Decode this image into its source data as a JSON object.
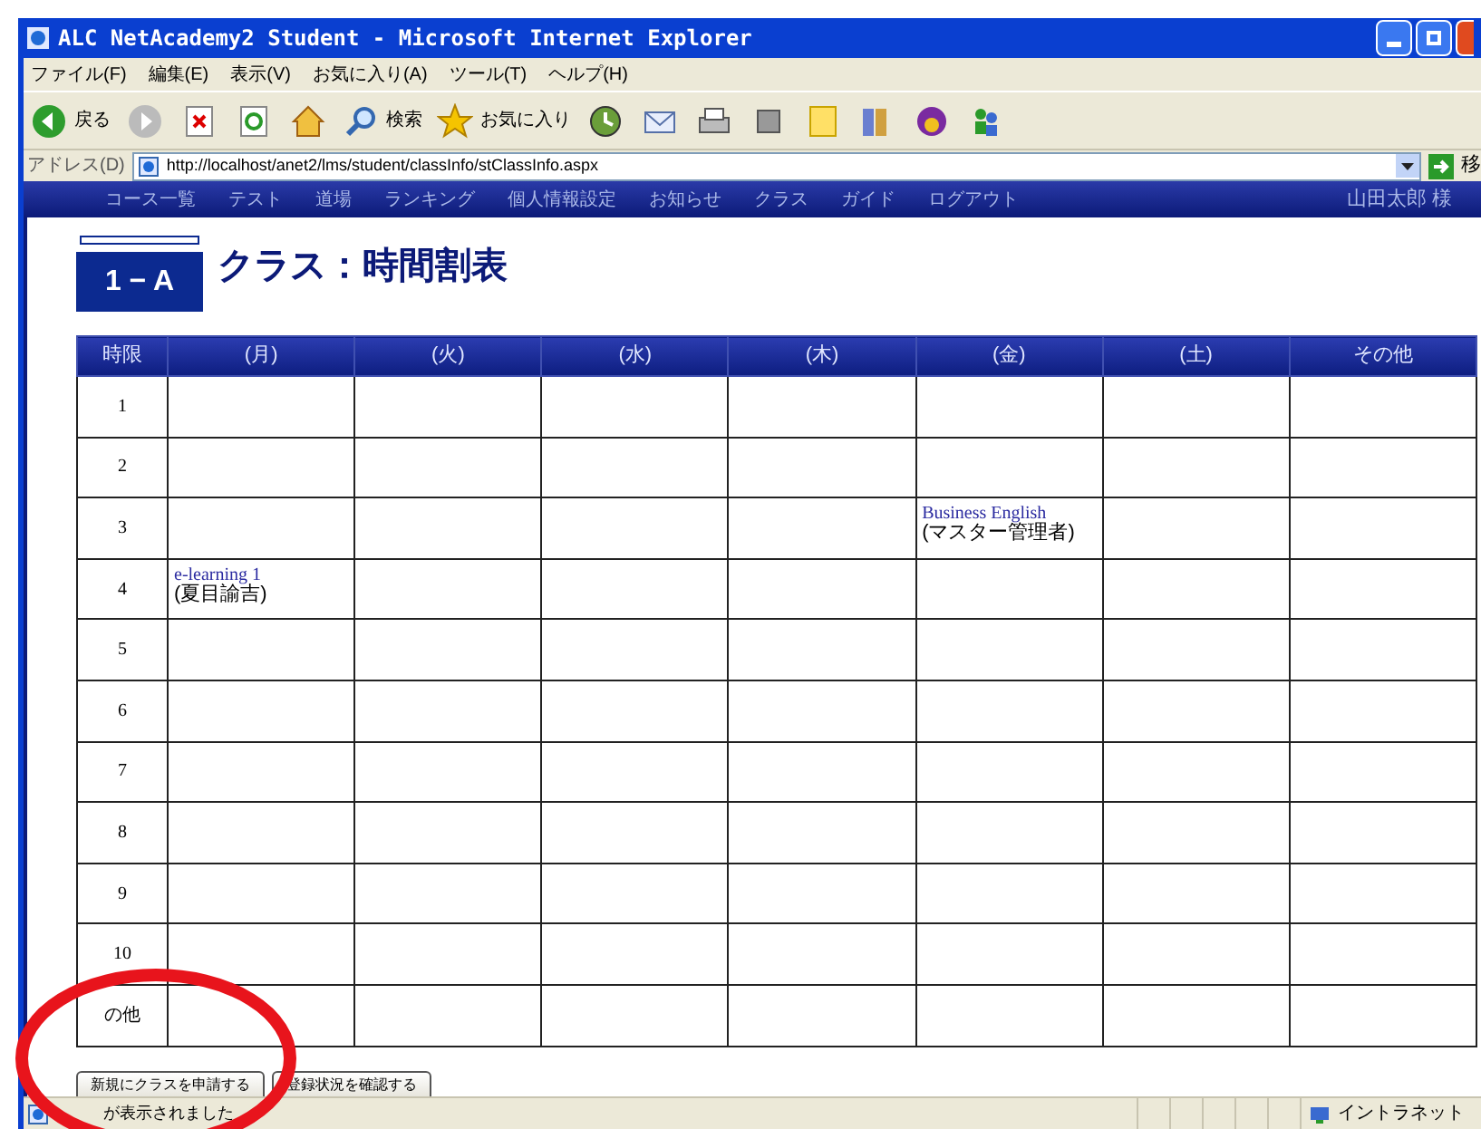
{
  "window": {
    "title": "ALC NetAcademy2 Student - Microsoft Internet Explorer"
  },
  "menu_bar": [
    "ファイル(F)",
    "編集(E)",
    "表示(V)",
    "お気に入り(A)",
    "ツール(T)",
    "ヘルプ(H)"
  ],
  "toolbar": {
    "back": "戻る",
    "search": "検索",
    "favorites": "お気に入り"
  },
  "address_bar": {
    "label": "アドレス(D)",
    "value": "http://localhost/anet2/lms/student/classInfo/stClassInfo.aspx",
    "go": "移"
  },
  "nav": {
    "items": [
      "コース一覧",
      "テスト",
      "道場",
      "ランキング",
      "個人情報設定",
      "お知らせ",
      "クラス",
      "ガイド",
      "ログアウト"
    ],
    "user": "山田太郎 様"
  },
  "page": {
    "logo": "1 − A",
    "title": "クラス：時間割表"
  },
  "table": {
    "columns": [
      "時限",
      "(月)",
      "(火)",
      "(水)",
      "(木)",
      "(金)",
      "(土)",
      "その他"
    ],
    "rows": [
      [
        {
          "period": "1"
        },
        {},
        {},
        {},
        {},
        {},
        {},
        {}
      ],
      [
        {
          "period": "2"
        },
        {},
        {},
        {},
        {},
        {},
        {},
        {}
      ],
      [
        {
          "period": "3"
        },
        {},
        {},
        {},
        {},
        {
          "course": "Business English",
          "teacher": "(マスター管理者)"
        },
        {},
        {}
      ],
      [
        {
          "period": "4"
        },
        {
          "course": "e-learning 1",
          "teacher": "(夏目諭吉)"
        },
        {},
        {},
        {},
        {},
        {},
        {}
      ],
      [
        {
          "period": "5"
        },
        {},
        {},
        {},
        {},
        {},
        {},
        {}
      ],
      [
        {
          "period": "6"
        },
        {},
        {},
        {},
        {},
        {},
        {},
        {}
      ],
      [
        {
          "period": "7"
        },
        {},
        {},
        {},
        {},
        {},
        {},
        {}
      ],
      [
        {
          "period": "8"
        },
        {},
        {},
        {},
        {},
        {},
        {},
        {}
      ],
      [
        {
          "period": "9"
        },
        {},
        {},
        {},
        {},
        {},
        {},
        {}
      ],
      [
        {
          "period": "10"
        },
        {},
        {},
        {},
        {},
        {},
        {},
        {}
      ],
      [
        {
          "period": "の他"
        },
        {},
        {},
        {},
        {},
        {},
        {},
        {}
      ]
    ]
  },
  "buttons": [
    "新規にクラスを申請する",
    "登録状況を確認する"
  ],
  "status_bar": {
    "text": "が表示されました",
    "zone": "イントラネット"
  }
}
